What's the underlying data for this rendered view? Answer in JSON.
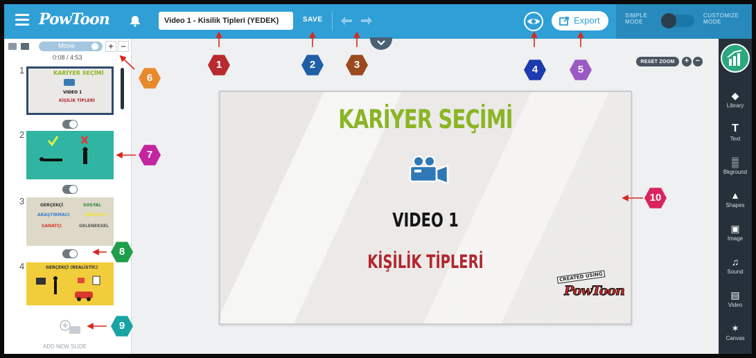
{
  "app": {
    "logo": "PowToon",
    "title_value": "Video 1 - Kisilik Tipleri (YEDEK)",
    "save": "SAVE",
    "export": "Export",
    "mode_simple": "SIMPLE mode",
    "mode_customize": "CUSTOMIZE mode"
  },
  "left_panel": {
    "view_mode": "Movie",
    "timecode": "0:08 / 4:53",
    "add_slide": "ADD NEW SLIDE",
    "slides": [
      {
        "num": "1",
        "line1": "KARİYER SEÇİMİ",
        "line2": "VIDEO 1",
        "line3": "KİŞİLİK TİPLERİ"
      },
      {
        "num": "2"
      },
      {
        "num": "3",
        "cells": [
          "GERÇEKÇİ",
          "SOSYAL",
          "ARAŞTIRMACI",
          "GİRİŞİMCİ",
          "SANATÇI",
          "GELENEKSEL"
        ]
      },
      {
        "num": "4",
        "line1": "GERÇEKÇİ (REALİSTİC)"
      }
    ]
  },
  "canvas": {
    "reset_zoom": "RESET ZOOM",
    "zoom_in": "+",
    "zoom_out": "−",
    "title": "KARİYER SEÇİMİ",
    "subtitle": "VIDEO 1",
    "subtitle2": "KİŞİLİK TİPLERİ",
    "badge_top": "CREATED USING",
    "badge_logo": "PowToon"
  },
  "right_toolbar": [
    {
      "label": "Library",
      "icon": "cube-icon"
    },
    {
      "label": "Text",
      "icon": "text-icon"
    },
    {
      "label": "Bkground",
      "icon": "checker-icon"
    },
    {
      "label": "Shapes",
      "icon": "shapes-icon"
    },
    {
      "label": "Image",
      "icon": "image-icon"
    },
    {
      "label": "Sound",
      "icon": "music-icon"
    },
    {
      "label": "Video",
      "icon": "video-icon"
    },
    {
      "label": "Canvas",
      "icon": "canvas-icon"
    }
  ],
  "markers": [
    "1",
    "2",
    "3",
    "4",
    "5",
    "6",
    "7",
    "8",
    "9",
    "10"
  ],
  "colors": {
    "topbar": "#2f9fd6",
    "marker_red": "#b72a2e",
    "marker_blue": "#1f5fa8",
    "marker_brown": "#9b4a1e",
    "marker_navy": "#1d3bb0",
    "marker_purple": "#9b59c4",
    "marker_orange": "#e88a2a",
    "marker_magenta": "#c3249f",
    "marker_green": "#1f9e4b",
    "marker_teal": "#1aa3a3",
    "marker_pink": "#d8245f"
  }
}
